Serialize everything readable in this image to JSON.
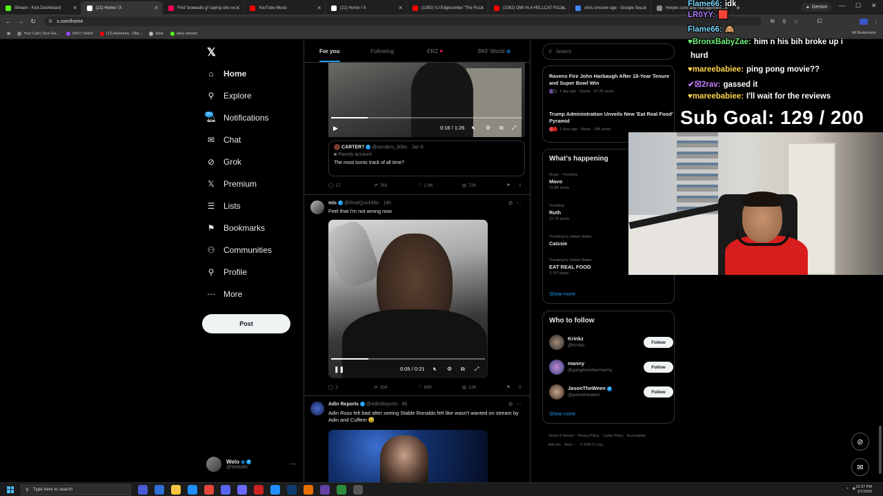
{
  "browser": {
    "tabs": [
      {
        "label": "Stream - Kick Dashboard",
        "color": "#53fc18",
        "active": false
      },
      {
        "label": "(21) Home / X",
        "color": "#ffffff",
        "active": true
      },
      {
        "label": "Find 'brawadis gf saying she ne...",
        "color": "#ff0050",
        "active": false
      },
      {
        "label": "YouTube Music",
        "color": "#ff0000",
        "active": false
      },
      {
        "label": "(21) Home / X",
        "color": "#ffffff",
        "active": false
      },
      {
        "label": "(1082) VJ Edgecombe \"The Fut...",
        "color": "#ff0000",
        "active": false
      },
      {
        "label": "(1082) OMI IN A HELLCAT Pizza...",
        "color": "#ff0000",
        "active": false
      },
      {
        "label": "chris smoove age - Google Sea...",
        "color": "#4285f4",
        "active": false
      },
      {
        "label": "Herpes cure and management...",
        "color": "#888888",
        "active": false
      }
    ],
    "gemini_label": "Gemini",
    "url": "x.com/home",
    "bookmarks": [
      {
        "label": "Your Cart | Scul Ga...",
        "color": "#888888"
      },
      {
        "label": "(99+) Twitch",
        "color": "#9146ff"
      },
      {
        "label": "(12) Aventura - Obs...",
        "color": "#ff0000"
      },
      {
        "label": "allas",
        "color": "#bbbbbb"
      },
      {
        "label": "abey stream",
        "color": "#53fc18"
      }
    ],
    "all_bookmarks": "All Bookmarks"
  },
  "nav": {
    "logo": "𝕏",
    "items": [
      {
        "label": "Home",
        "icon": "⌂"
      },
      {
        "label": "Explore",
        "icon": "⚲"
      },
      {
        "label": "Notifications",
        "icon": "🔔︎"
      },
      {
        "label": "Chat",
        "icon": "✉"
      },
      {
        "label": "Grok",
        "icon": "⊘"
      },
      {
        "label": "Premium",
        "icon": "𝕏"
      },
      {
        "label": "Lists",
        "icon": "☰"
      },
      {
        "label": "Bookmarks",
        "icon": "⚑"
      },
      {
        "label": "Communities",
        "icon": "⚇"
      },
      {
        "label": "Profile",
        "icon": "⚲"
      },
      {
        "label": "More",
        "icon": "⋯"
      }
    ],
    "notif_badge": "20+",
    "post_label": "Post",
    "account": {
      "name": "Welo",
      "handle": "@WeloBk"
    }
  },
  "feed": {
    "tabs": [
      "For you",
      "Following",
      "ERZ",
      "BKF World"
    ],
    "video1": {
      "time": "0:16 / 1:26",
      "progress": 0.19
    },
    "quote": {
      "name": "CARTER?",
      "handle": "@sonders_808s · Jan 6",
      "parody": "Parody account",
      "text": "The most iconic track of all time?"
    },
    "actions1": {
      "replies": "17",
      "reposts": "783",
      "likes": "2.6K",
      "views": "72K"
    },
    "tweet2": {
      "name": "mis",
      "handle": "@RealQuickMis · 18h",
      "text": "Feel that I'm not wrong now",
      "time": "0:05 / 0:21",
      "progress": 0.24
    },
    "actions2": {
      "replies": "2",
      "reposts": "154",
      "likes": "689",
      "views": "12K"
    },
    "tweet3": {
      "name": "Adin Reports",
      "handle": "@AdinReports · 8h",
      "text": "Adin Ross felt bad after seeing Stable Ronaldo felt like wasn't wanted on stream by Adin and Cuffem 😅"
    }
  },
  "sidebar": {
    "search_placeholder": "Search",
    "news": [
      {
        "title": "Ravens Fire John Harbaugh After 18-Year Tenure and Super Bowl Win",
        "meta": "1 day ago · Sports · 57.2K posts"
      },
      {
        "title": "Trump Administration Unveils New 'Eat Real Food' Pyramid",
        "meta": "1 hour ago · News · 18K posts"
      }
    ],
    "happening_title": "What's happening",
    "trends": [
      {
        "context": "Music · Trending",
        "name": "Mavo",
        "posts": "12.8K posts"
      },
      {
        "context": "Trending",
        "name": "Ruth",
        "posts": "21.7K posts"
      },
      {
        "context": "Trending in United States",
        "name": "Caissie",
        "posts": ""
      },
      {
        "context": "Trending in United States",
        "name": "EAT REAL FOOD",
        "posts": "2,787 posts"
      }
    ],
    "show_more": "Show more",
    "wtf_title": "Who to follow",
    "who_to_follow": [
      {
        "name": "Krinkz",
        "handle": "@Krinkz",
        "verified": false
      },
      {
        "name": "manny",
        "handle": "@gangmembermanny",
        "verified": false
      },
      {
        "name": "JasonTheWeen",
        "handle": "@jasontheween",
        "verified": true
      }
    ],
    "follow_label": "Follow",
    "footer": [
      "Terms of Service",
      "Privacy Policy",
      "Cookie Policy",
      "Accessibility",
      "Ads info",
      "More ···",
      "© 2026 X Corp."
    ]
  },
  "stream": {
    "chat": [
      {
        "user": "Flame66:",
        "msg": "idk",
        "color": "#7bd6ff"
      },
      {
        "user": "LR0YY:",
        "msg": "🟥",
        "color": "#b07cff"
      },
      {
        "user": "Flame66:",
        "msg": "🙈",
        "color": "#7bd6ff"
      },
      {
        "user": "♥BronxBabyZae:",
        "msg": "him n his bih broke up i",
        "color": "#6ef07a"
      },
      {
        "user": "",
        "msg": "hurd",
        "color": "#ffffff"
      },
      {
        "user": "♥mareebabiee:",
        "msg": "ping pong movie??",
        "color": "#ffd54a"
      },
      {
        "user": "✔☒2rav:",
        "msg": "gassed it",
        "color": "#c77dff"
      },
      {
        "user": "♥mareebabiee:",
        "msg": "I'll wait for the reviews",
        "color": "#ffd54a"
      }
    ],
    "sub_goal": "Sub Goal:  129 / 200"
  },
  "taskbar": {
    "search_placeholder": "Type here to search",
    "time": "12:37 PM",
    "date": "1/7/2026"
  }
}
